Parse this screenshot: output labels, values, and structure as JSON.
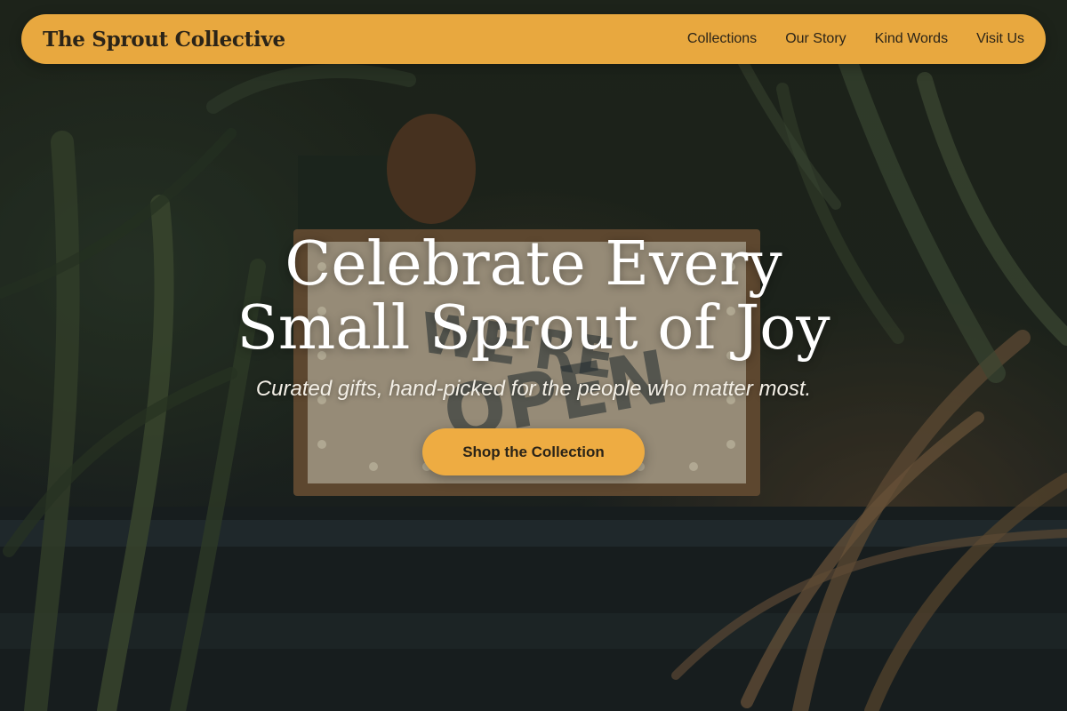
{
  "nav": {
    "brand": "The Sprout Collective",
    "links": [
      "Collections",
      "Our Story",
      "Kind Words",
      "Visit Us"
    ]
  },
  "hero": {
    "title": "Celebrate Every Small Sprout of Joy",
    "subtitle": "Curated gifts, hand-picked for the people who matter most.",
    "cta_label": "Shop the Collection",
    "background_sign_text": "WE'RE OPEN"
  },
  "colors": {
    "accent": "#e8a83f",
    "cta": "#eeac42",
    "nav_text": "#2b2418",
    "hero_text": "#ffffff"
  }
}
